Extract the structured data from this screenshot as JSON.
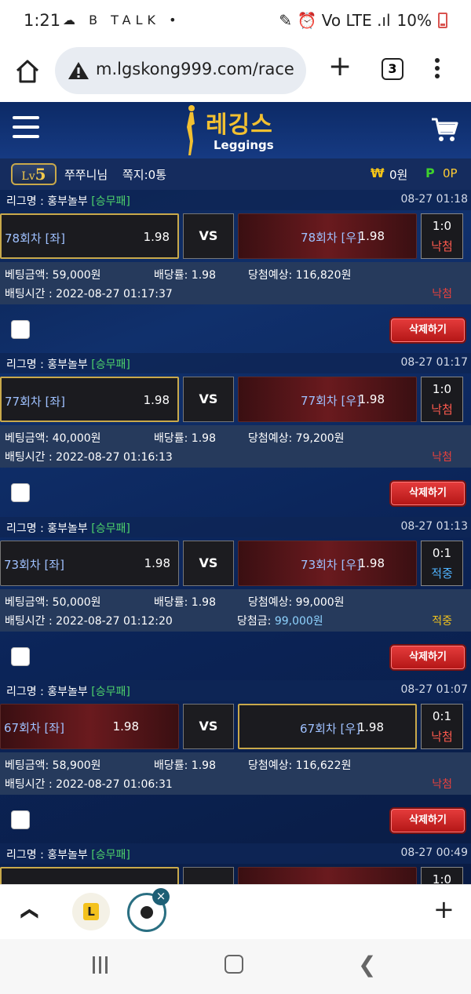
{
  "status_bar": {
    "time": "1:21",
    "left_icons": "☁ B TALK •",
    "right_icons": "✎ ⏰ Vo LTE .ıl",
    "battery": "10%"
  },
  "browser": {
    "url": "m.lgskong999.com/race",
    "tab_count": "3"
  },
  "site": {
    "logo_title": "레깅스",
    "logo_sub": "Leggings",
    "user": {
      "level_prefix": "Lv",
      "level": "5",
      "name": "쭈쭈니님",
      "messages": "쪽지:0통",
      "won_symbol": "₩",
      "money": "0원",
      "point_symbol": "P",
      "points": "0P"
    },
    "bets": [
      {
        "league": "리그명 : 홍부놀부",
        "type": "[승무패]",
        "date": "08-27 01:18",
        "left_team": "78회차 [좌]",
        "left_odds": "1.98",
        "vs": "VS",
        "right_team": "78회차 [우]",
        "right_odds": "1.98",
        "score": "1:0",
        "score_result": "낙첨",
        "bet_amount": "베팅금액: 59,000원",
        "rate": "배당률: 1.98",
        "expected": "당첨예상: 116,820원",
        "bet_time": "배팅시간 : 2022-08-27 01:17:37",
        "win_label": "",
        "win_amount": "",
        "result": "낙첨",
        "delete_label": "삭제하기"
      },
      {
        "league": "리그명 : 홍부놀부",
        "type": "[승무패]",
        "date": "08-27 01:17",
        "left_team": "77회차 [좌]",
        "left_odds": "1.98",
        "vs": "VS",
        "right_team": "77회차 [우]",
        "right_odds": "1.98",
        "score": "1:0",
        "score_result": "낙첨",
        "bet_amount": "베팅금액: 40,000원",
        "rate": "배당률: 1.98",
        "expected": "당첨예상: 79,200원",
        "bet_time": "배팅시간 : 2022-08-27 01:16:13",
        "win_label": "",
        "win_amount": "",
        "result": "낙첨",
        "delete_label": "삭제하기"
      },
      {
        "league": "리그명 : 홍부놀부",
        "type": "[승무패]",
        "date": "08-27 01:13",
        "left_team": "73회차 [좌]",
        "left_odds": "1.98",
        "vs": "VS",
        "right_team": "73회차 [우]",
        "right_odds": "1.98",
        "score": "0:1",
        "score_result": "적중",
        "bet_amount": "베팅금액: 50,000원",
        "rate": "배당률: 1.98",
        "expected": "당첨예상: 99,000원",
        "bet_time": "배팅시간 : 2022-08-27 01:12:20",
        "win_label": "당첨금: ",
        "win_amount": "99,000원",
        "result": "적중",
        "delete_label": "삭제하기"
      },
      {
        "league": "리그명 : 홍부놀부",
        "type": "[승무패]",
        "date": "08-27 01:07",
        "left_team": "67회차 [좌]",
        "left_odds": "1.98",
        "vs": "VS",
        "right_team": "67회차 [우]",
        "right_odds": "1.98",
        "score": "0:1",
        "score_result": "낙첨",
        "bet_amount": "베팅금액: 58,900원",
        "rate": "배당률: 1.98",
        "expected": "당첨예상: 116,622원",
        "bet_time": "배팅시간 : 2022-08-27 01:06:31",
        "win_label": "",
        "win_amount": "",
        "result": "낙첨",
        "delete_label": "삭제하기"
      },
      {
        "league": "리그명 : 홍부놀부",
        "type": "[승무패]",
        "date": "08-27 00:49",
        "score": "1:0"
      }
    ]
  },
  "bottom_bar": {
    "ext_l": "L",
    "ext_close": "×"
  }
}
